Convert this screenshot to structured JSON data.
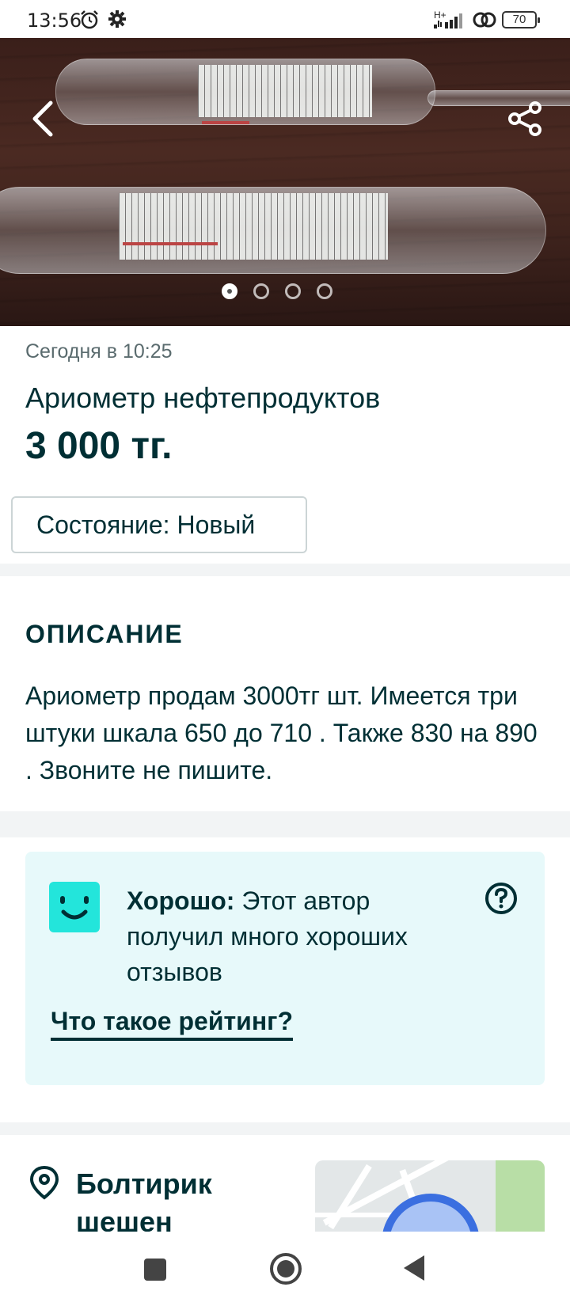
{
  "status_bar": {
    "time": "13:56",
    "network": "H+",
    "battery": "70"
  },
  "gallery": {
    "total": 4,
    "active_index": 0
  },
  "listing": {
    "posted": "Сегодня в 10:25",
    "title": "Ариометр нефтепродуктов",
    "price": "3 000 тг.",
    "condition": "Состояние: Новый"
  },
  "description": {
    "heading": "ОПИСАНИЕ",
    "text": "Ариометр продам 3000тг шт. Имеется три штуки шкала 650 до 710 . Также 830 на 890 . Звоните не пишите."
  },
  "rating": {
    "label": "Хорошо:",
    "text": " Этот автор получил много хороших отзывов",
    "link": "Что такое рейтинг?"
  },
  "location": {
    "name": "Болтирик шешен"
  },
  "colors": {
    "primary": "#002f34",
    "rating_bg": "#e7f9fa",
    "smile": "#23e5db",
    "divider": "#f2f4f5"
  },
  "icons": {
    "back": "back-arrow-icon",
    "share": "share-icon",
    "smile": "smile-icon",
    "help": "question-icon",
    "pin": "location-pin-icon"
  }
}
